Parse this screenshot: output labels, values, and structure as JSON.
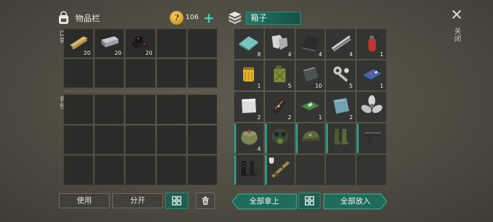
{
  "inventory": {
    "title": "物品栏",
    "coins": "106",
    "coin_symbol": "?",
    "add_label": "+",
    "pocket_label": "口袋",
    "bag_label": "背包",
    "pocket_slots": [
      {
        "item": "wooden-planks",
        "qty": "20"
      },
      {
        "item": "iron-ingot",
        "qty": "20"
      },
      {
        "item": "coal",
        "qty": "20"
      },
      {},
      {},
      {},
      {},
      {},
      {},
      {}
    ],
    "bag_slots": [
      {},
      {},
      {},
      {},
      {},
      {},
      {},
      {},
      {},
      {},
      {},
      {},
      {},
      {},
      {}
    ]
  },
  "box": {
    "title": "箱子",
    "close_symbol": "✕",
    "close_label": "关闭",
    "slots": [
      {
        "item": "glass-sheet",
        "qty": "8"
      },
      {
        "item": "metal-scrap",
        "qty": "4"
      },
      {
        "item": "rubber-mat",
        "qty": "4"
      },
      {
        "item": "metal-rods",
        "qty": "4"
      },
      {
        "item": "fire-extinguisher",
        "qty": "1"
      },
      {
        "item": "oil-filter",
        "qty": "1"
      },
      {
        "item": "jerry-can",
        "qty": "5"
      },
      {
        "item": "steel-plate",
        "qty": "10"
      },
      {
        "item": "engine-parts",
        "qty": "5"
      },
      {
        "item": "circuit-board",
        "qty": "1"
      },
      {
        "item": "aluminum-sheet",
        "qty": "2"
      },
      {
        "item": "tool-bag",
        "qty": "2"
      },
      {
        "item": "green-chip",
        "qty": "1"
      },
      {
        "item": "tinted-glass",
        "qty": "2"
      },
      {
        "item": "propeller",
        "qty": ""
      },
      {
        "item": "medical-pouch",
        "qty": "4",
        "equip": true
      },
      {
        "item": "gas-mask",
        "qty": "",
        "equip": true
      },
      {
        "item": "military-cap",
        "qty": "",
        "equip": true
      },
      {
        "item": "military-boots",
        "qty": "",
        "equip": true
      },
      {
        "item": "pistol",
        "qty": "",
        "equip": true
      },
      {
        "item": "black-boots",
        "qty": "",
        "equip": true
      },
      {
        "item": "camo-rifle",
        "qty": "",
        "equip": true,
        "badge": true
      },
      {},
      {},
      {}
    ]
  },
  "buttons": {
    "use": "使用",
    "split": "分开",
    "take_all": "全部拿上",
    "put_all": "全部放入"
  },
  "colors": {
    "accent_teal": "#2a9a84",
    "coin_gold": "#d39a20",
    "slot_bg": "#2b2b29"
  }
}
